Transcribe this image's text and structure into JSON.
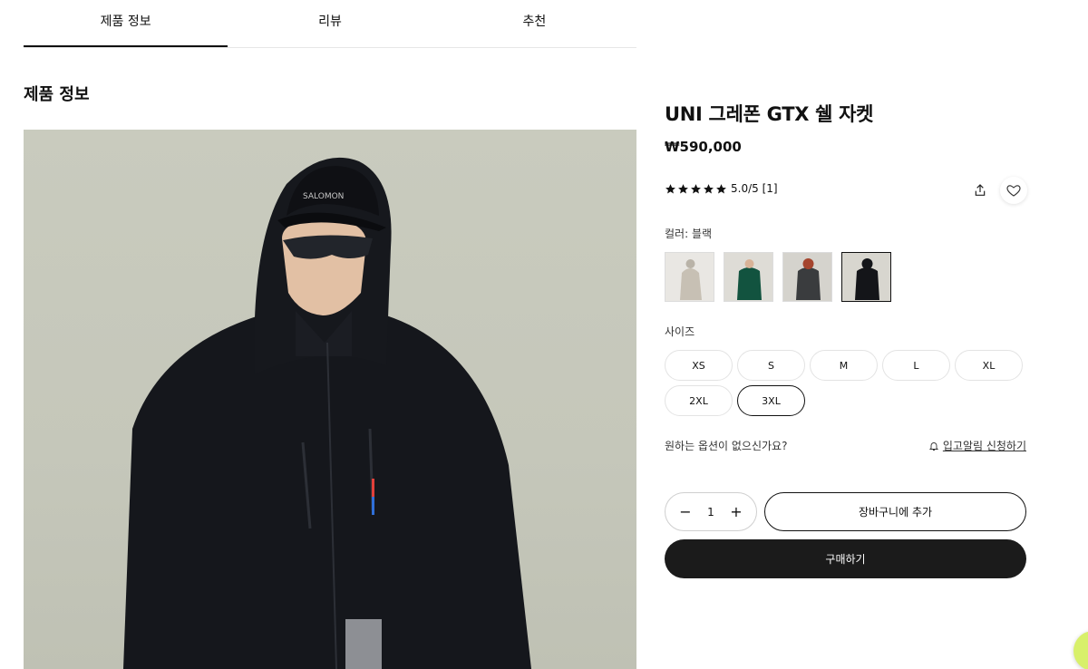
{
  "tabs": [
    {
      "label": "제품 정보",
      "active": true
    },
    {
      "label": "리뷰",
      "active": false
    },
    {
      "label": "추천",
      "active": false
    }
  ],
  "section_title": "제품 정보",
  "product": {
    "title": "UNI 그레폰 GTX 쉘 자켓",
    "price": "₩590,000",
    "rating_text": "5.0/5 [1]",
    "rating_stars": 5,
    "photo_brand_text": "SALOMON"
  },
  "color": {
    "label": "컬러: 블랙",
    "swatch_names": [
      "beige-jacket",
      "green-jacket",
      "grey-jacket",
      "black-jacket"
    ],
    "selected_index": 3
  },
  "size": {
    "label": "사이즈",
    "options": [
      "XS",
      "S",
      "M",
      "L",
      "XL",
      "2XL",
      "3XL"
    ],
    "selected": "3XL"
  },
  "no_option_text": "원하는 옵션이 없으신가요?",
  "restock_text": "입고알림 신청하기",
  "quantity": {
    "value": "1",
    "minus": "−",
    "plus": "+"
  },
  "buttons": {
    "cart": "장바구니에 추가",
    "buy": "구매하기"
  },
  "colors": {
    "accent": "#1b1b1b",
    "chat": "#d8f06a"
  }
}
